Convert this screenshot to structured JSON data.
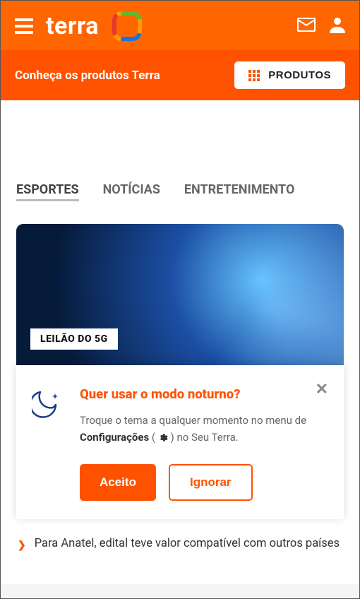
{
  "header": {
    "brand": "terra"
  },
  "subheader": {
    "text": "Conheça os produtos Terra",
    "button": "PRODUTOS"
  },
  "tabs": [
    {
      "label": "ESPORTES",
      "active": true
    },
    {
      "label": "NOTÍCIAS",
      "active": false
    },
    {
      "label": "ENTRETENIMENTO",
      "active": false
    }
  ],
  "card": {
    "badge": "LEILÃO DO 5G"
  },
  "news": [
    {
      "text": "Para Anatel, edital teve valor compatível com outros países"
    }
  ],
  "dark_mode_prompt": {
    "title": "Quer usar o modo noturno?",
    "description_pre": "Troque o tema a qualquer momento no menu de ",
    "description_bold": "Configurações",
    "description_post": " no Seu Terra.",
    "accept": "Aceito",
    "dismiss": "Ignorar"
  }
}
